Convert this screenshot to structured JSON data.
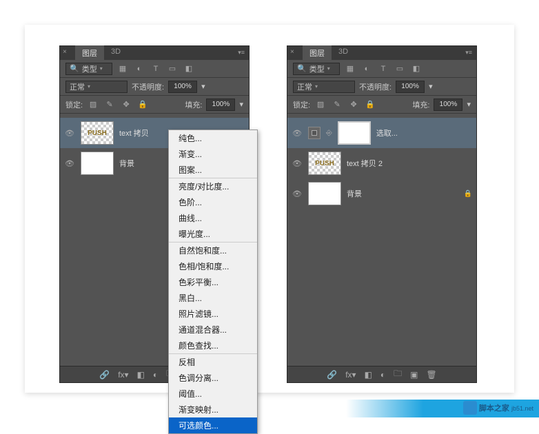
{
  "tabs": {
    "layers": "图层",
    "threeD": "3D"
  },
  "filterRow": {
    "kind": "类型"
  },
  "blendRow": {
    "mode": "正常",
    "opacityLabel": "不透明度:",
    "opacityValue": "100%"
  },
  "lockRow": {
    "lockLabel": "锁定:",
    "fillLabel": "填充:",
    "fillValue": "100%"
  },
  "leftLayers": [
    {
      "name": "text 拷贝",
      "type": "push",
      "selected": true
    },
    {
      "name": "背景",
      "type": "white",
      "locked": true
    }
  ],
  "rightLayers": [
    {
      "name": "选取...",
      "type": "mask",
      "selected": true
    },
    {
      "name": "text 拷贝 2",
      "type": "push"
    },
    {
      "name": "背景",
      "type": "white",
      "locked": true
    }
  ],
  "menu": {
    "g1": [
      "纯色...",
      "渐变...",
      "图案..."
    ],
    "g2": [
      "亮度/对比度...",
      "色阶...",
      "曲线...",
      "曝光度..."
    ],
    "g3": [
      "自然饱和度...",
      "色相/饱和度...",
      "色彩平衡...",
      "黑白...",
      "照片滤镜...",
      "通道混合器...",
      "颜色查找..."
    ],
    "g4": [
      "反相",
      "色调分离...",
      "阈值...",
      "渐变映射..."
    ],
    "highlight": "可选颜色..."
  },
  "watermark": {
    "zh": "脚本之家",
    "en": "jb51.net"
  }
}
